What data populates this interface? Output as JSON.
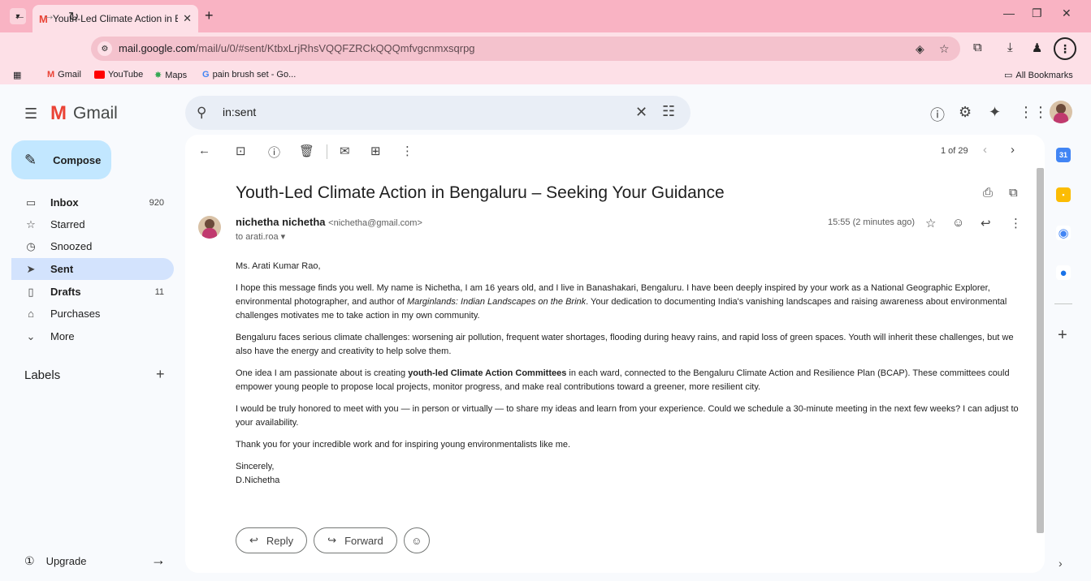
{
  "browser": {
    "tab_title": "Youth-Led Climate Action in Be",
    "url_host": "mail.google.com",
    "url_path": "/mail/u/0/#sent/KtbxLrjRhsVQQFZRCkQQQmfvgcnmxsqrpg",
    "bookmarks": [
      "Gmail",
      "YouTube",
      "Maps",
      "pain brush set - Go..."
    ],
    "all_bookmarks": "All Bookmarks"
  },
  "gmail": {
    "app_name": "Gmail",
    "search_value": "in:sent"
  },
  "nav": {
    "compose": "Compose",
    "items": [
      {
        "label": "Inbox",
        "count": "920"
      },
      {
        "label": "Starred",
        "count": ""
      },
      {
        "label": "Snoozed",
        "count": ""
      },
      {
        "label": "Sent",
        "count": ""
      },
      {
        "label": "Drafts",
        "count": "11"
      },
      {
        "label": "Purchases",
        "count": ""
      },
      {
        "label": "More",
        "count": ""
      }
    ],
    "labels_heading": "Labels",
    "upgrade": "Upgrade"
  },
  "toolbar": {
    "pager": "1 of 29"
  },
  "message": {
    "subject": "Youth-Led Climate Action in Bengaluru – Seeking Your Guidance",
    "sender_name": "nichetha nichetha",
    "sender_email": "<nichetha@gmail.com>",
    "to": "to arati.roa",
    "time": "15:55 (2 minutes ago)",
    "greeting": "Ms. Arati Kumar Rao,",
    "p1_a": "I hope this message finds you well. My name is Nichetha, I am 16 years old, and I live in Banashakari, Bengaluru. I have been deeply inspired by your work as a National Geographic Explorer, environmental photographer, and author of ",
    "p1_book": "Marginlands: Indian Landscapes on the Brink",
    "p1_b": ". Your dedication to documenting India's vanishing landscapes and raising awareness about environmental challenges motivates me to take action in my own community.",
    "p2": "Bengaluru faces serious climate challenges: worsening air pollution, frequent water shortages, flooding during heavy rains, and rapid loss of green spaces. Youth will inherit these challenges, but we also have the energy and creativity to help solve them.",
    "p3_a": "One idea I am passionate about is creating ",
    "p3_bold": "youth-led Climate Action Committees",
    "p3_b": " in each ward, connected to the Bengaluru Climate Action and Resilience Plan (BCAP). These committees could empower young people to propose local projects, monitor progress, and make real contributions toward a greener, more resilient city.",
    "p4": "I would be truly honored to meet with you — in person or virtually — to share my ideas and learn from your experience. Could we schedule a 30-minute meeting in the next few weeks? I can adjust to your availability.",
    "p5": "Thank you for your incredible work and for inspiring young environmentalists like me.",
    "closing": "Sincerely,",
    "signature": "D.Nichetha"
  },
  "actions": {
    "reply": "Reply",
    "forward": "Forward"
  },
  "colors": {
    "tab_strip": "#f9b3c3",
    "toolbar": "#fde0e7",
    "compose_bg": "#c2e7ff",
    "active_nav": "#d3e3fd"
  }
}
